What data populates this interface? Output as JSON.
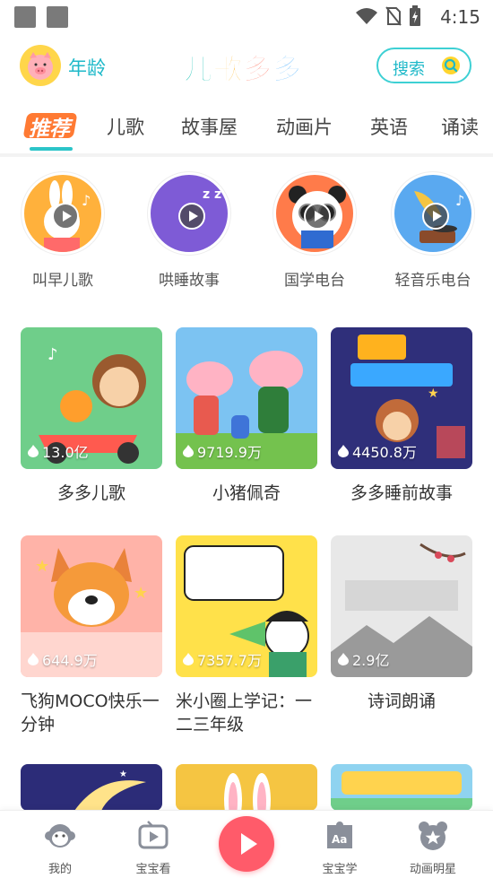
{
  "status_bar": {
    "time": "4:15"
  },
  "header": {
    "age_label": "年龄",
    "logo_text": [
      "儿",
      "歌",
      "多",
      "多"
    ],
    "logo_colors": [
      "#20c3b5",
      "#ffb21e",
      "#ff6a55",
      "#3aa8ff"
    ],
    "search_label": "搜索"
  },
  "tabs": [
    {
      "label": "推荐",
      "active": true
    },
    {
      "label": "儿歌",
      "active": false
    },
    {
      "label": "故事屋",
      "active": false
    },
    {
      "label": "动画片",
      "active": false
    },
    {
      "label": "英语",
      "active": false
    },
    {
      "label": "诵读",
      "active": false
    }
  ],
  "channels": [
    {
      "label": "叫早儿歌",
      "color": "#ffb13c"
    },
    {
      "label": "哄睡故事",
      "color": "#7e5bd6"
    },
    {
      "label": "国学电台",
      "color": "#ff7b4a"
    },
    {
      "label": "轻音乐电台",
      "color": "#5aa9f0"
    }
  ],
  "cards": [
    {
      "title": "多多儿歌",
      "count": "13.0亿",
      "bg": "#6fce8a"
    },
    {
      "title": "小猪佩奇",
      "count": "9719.9万",
      "bg": "#7cc3f2"
    },
    {
      "title": "多多睡前故事",
      "count": "4450.8万",
      "bg": "#2f2f7a"
    },
    {
      "title": "飞狗MOCO快乐一分钟",
      "count": "644.9万",
      "bg": "#ffb3a8"
    },
    {
      "title": "米小圈上学记：一二三年级",
      "count": "7357.7万",
      "bg": "#ffe14a"
    },
    {
      "title": "诗词朗诵",
      "count": "2.9亿",
      "bg": "#e8e8e8"
    }
  ],
  "bottom_nav": [
    {
      "label": "我的"
    },
    {
      "label": "宝宝看"
    },
    {
      "label": "宝宝学"
    },
    {
      "label": "动画明星"
    }
  ],
  "colors": {
    "accent": "#2bc4c8",
    "play": "#ff5b6a",
    "tab_active_bg": "#ff7a33"
  }
}
